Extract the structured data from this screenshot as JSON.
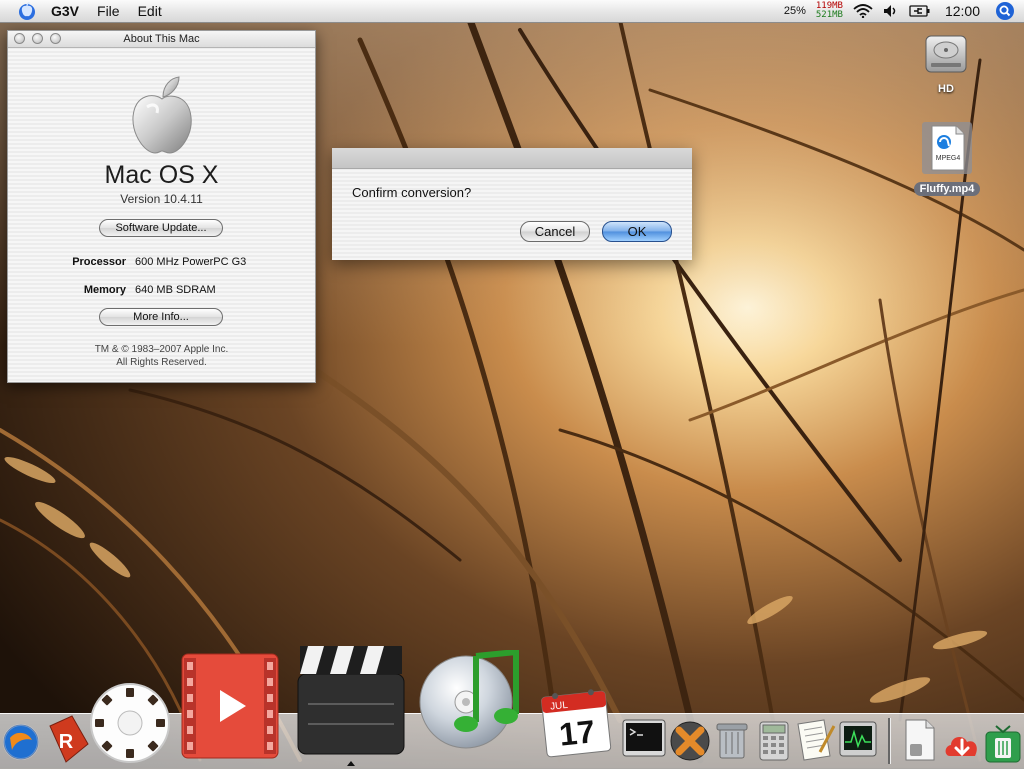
{
  "menubar": {
    "app_name": "G3V",
    "menus": [
      "File",
      "Edit"
    ],
    "cpu": "25%",
    "mem_used": "119MB",
    "mem_free": "521MB",
    "clock": "12:00"
  },
  "about": {
    "title": "About This Mac",
    "os_name": "Mac OS X",
    "version": "Version 10.4.11",
    "software_update_label": "Software Update...",
    "processor_label": "Processor",
    "processor_value": "600 MHz PowerPC G3",
    "memory_label": "Memory",
    "memory_value": "640 MB SDRAM",
    "more_info_label": "More Info...",
    "copyright_line1": "TM & © 1983–2007 Apple Inc.",
    "copyright_line2": "All Rights Reserved."
  },
  "alert": {
    "message": "Confirm conversion?",
    "cancel_label": "Cancel",
    "ok_label": "OK"
  },
  "desktop": {
    "hd_label": "HD",
    "file_label": "Fluffy.mp4",
    "file_badge": "MPEG4"
  },
  "dock": {
    "calendar_month": "JUL",
    "calendar_day": "17",
    "items": [
      "finder-icon",
      "red-r-app-icon",
      "view-master-icon",
      "video-player-icon",
      "clapperboard-icon",
      "itunes-icon",
      "ical-icon",
      "terminal-icon",
      "x-app-icon",
      "trash-can-icon",
      "calculator-icon",
      "textedit-icon",
      "activity-monitor-icon",
      "file-document-icon",
      "download-icon",
      "tv-trash-icon"
    ]
  },
  "colors": {
    "ok_button": "#5a98e4",
    "mem_used": "#b40000",
    "mem_free": "#1c7a1c"
  }
}
